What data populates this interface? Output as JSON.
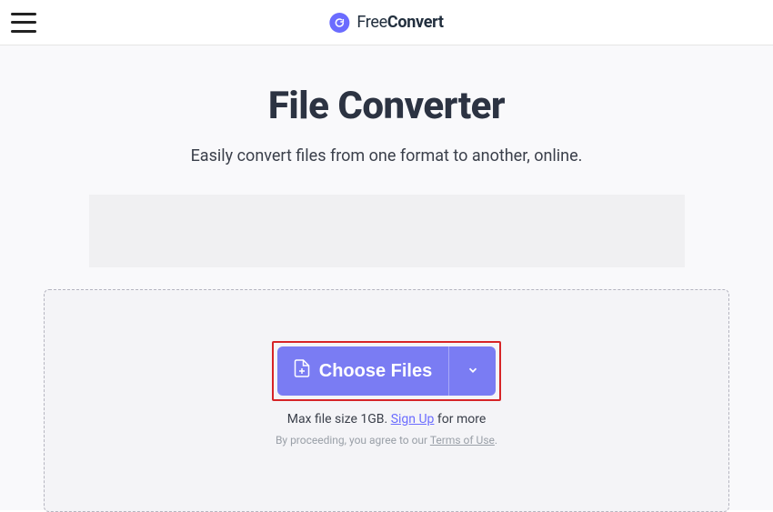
{
  "header": {
    "logo_free": "Free",
    "logo_convert": "Convert"
  },
  "main": {
    "title": "File Converter",
    "subtitle": "Easily convert files from one format to another, online."
  },
  "dropzone": {
    "choose_label": "Choose Files",
    "max_size_prefix": "Max file size 1GB. ",
    "signup_label": "Sign Up",
    "max_size_suffix": " for more",
    "terms_prefix": "By proceeding, you agree to our ",
    "terms_link": "Terms of Use",
    "terms_suffix": "."
  },
  "colors": {
    "accent": "#7a7cf3",
    "highlight": "#d62427"
  }
}
